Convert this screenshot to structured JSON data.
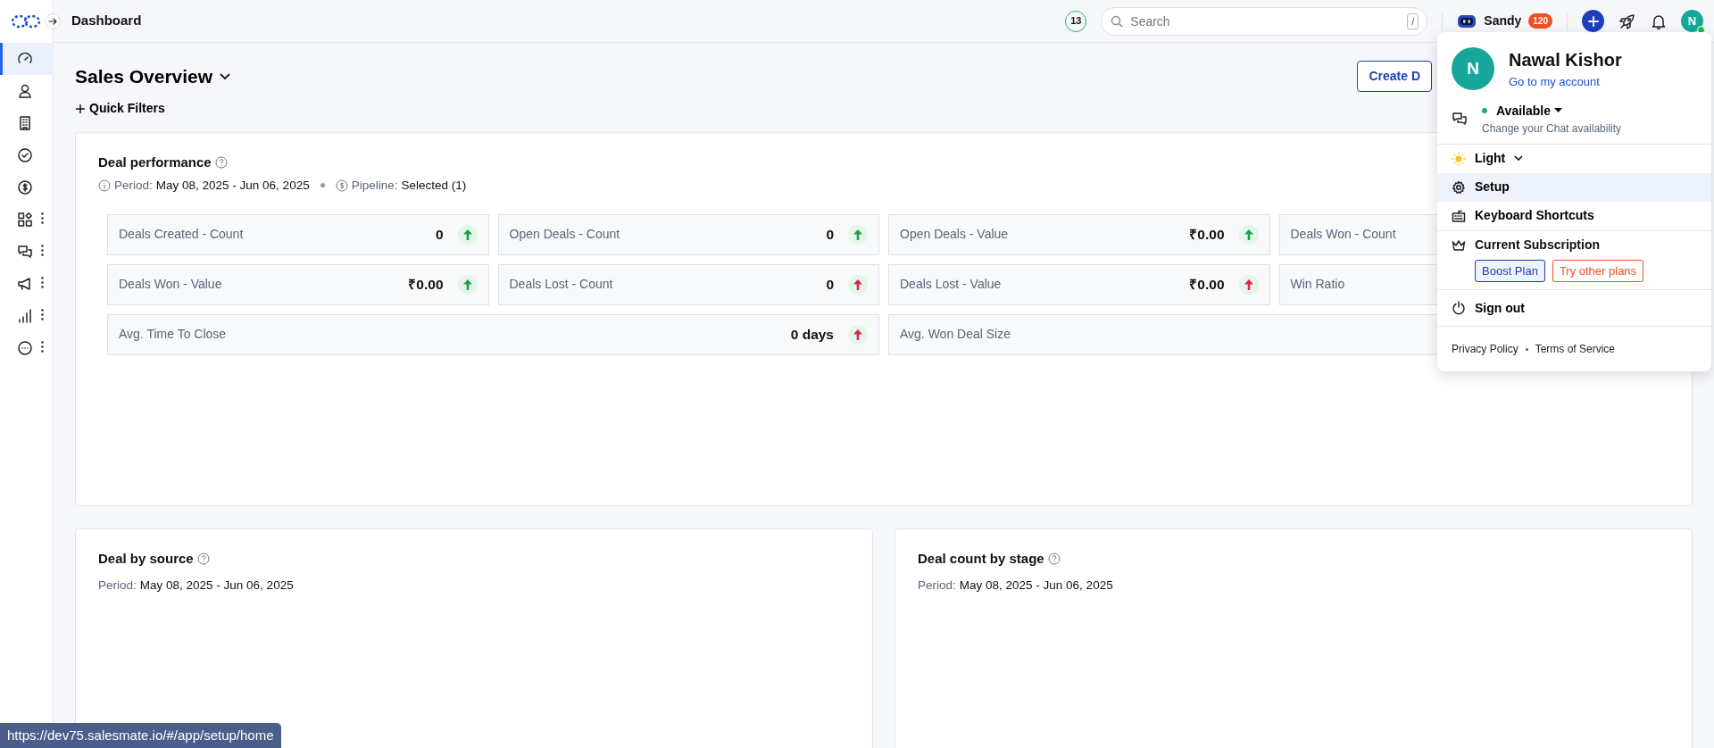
{
  "header": {
    "title": "Dashboard",
    "counter": "13",
    "search": {
      "placeholder": "Search",
      "shortcut": "/"
    },
    "bot": {
      "name": "Sandy",
      "count": "120"
    },
    "avatar": {
      "initial": "N",
      "online": true
    }
  },
  "sidebar": {
    "items": [
      {
        "selected": true,
        "menu": false
      },
      {
        "selected": false,
        "menu": false
      },
      {
        "selected": false,
        "menu": false
      },
      {
        "selected": false,
        "menu": false
      },
      {
        "selected": false,
        "menu": false
      },
      {
        "selected": false,
        "menu": true
      },
      {
        "selected": false,
        "menu": true
      },
      {
        "selected": false,
        "menu": true
      },
      {
        "selected": false,
        "menu": true
      },
      {
        "selected": false,
        "menu": true
      }
    ]
  },
  "dashboard": {
    "title": "Sales Overview",
    "quick_filters": "Quick Filters",
    "create_button": "Create D"
  },
  "performance": {
    "title": "Deal performance",
    "period_label": "Period:",
    "period": "May 08, 2025 - Jun 06, 2025",
    "pipeline_label": "Pipeline:",
    "pipeline": "Selected (1)",
    "metrics": [
      {
        "label": "Deals Created - Count",
        "value": "0",
        "color": "#1f9d4c",
        "wide": false
      },
      {
        "label": "Open Deals - Count",
        "value": "0",
        "color": "#1f9d4c",
        "wide": false
      },
      {
        "label": "Open Deals - Value",
        "value": "₹0.00",
        "color": "#1f9d4c",
        "wide": false
      },
      {
        "label": "Deals Won - Count",
        "wide": false
      },
      {
        "label": "Deals Won - Value",
        "value": "₹0.00",
        "color": "#1f9d4c",
        "wide": false
      },
      {
        "label": "Deals Lost - Count",
        "value": "0",
        "color": "#e0244f",
        "wide": false
      },
      {
        "label": "Deals Lost - Value",
        "value": "₹0.00",
        "color": "#e0244f",
        "wide": false
      },
      {
        "label": "Win Ratio",
        "wide": false
      },
      {
        "label": "Avg. Time To Close",
        "value": "0 days",
        "color": "#e0244f",
        "wide": true
      },
      {
        "label": "Avg. Won Deal Size",
        "wide": true
      }
    ]
  },
  "charts": [
    {
      "title": "Deal by source",
      "period_label": "Period:",
      "period": "May 08, 2025 - Jun 06, 2025"
    },
    {
      "title": "Deal count by stage",
      "period_label": "Period:",
      "period": "May 08, 2025 - Jun 06, 2025"
    }
  ],
  "account_menu": {
    "initial": "N",
    "name": "Nawal Kishor",
    "link": "Go to my account",
    "availability": {
      "status": "Available",
      "color": "#22b35e",
      "hint": "Change your Chat availability"
    },
    "theme": "Light",
    "items": [
      {
        "label": "Setup",
        "selected": true
      },
      {
        "label": "Keyboard Shortcuts",
        "selected": false
      }
    ],
    "subscription": {
      "title": "Current Subscription",
      "plan": "Boost Plan",
      "other": "Try other plans"
    },
    "sign_out": "Sign out",
    "footer": [
      "Privacy Policy",
      "Terms of Service"
    ]
  },
  "status_bar": {
    "url": "https://dev75.salesmate.io/#/app/setup/home"
  }
}
